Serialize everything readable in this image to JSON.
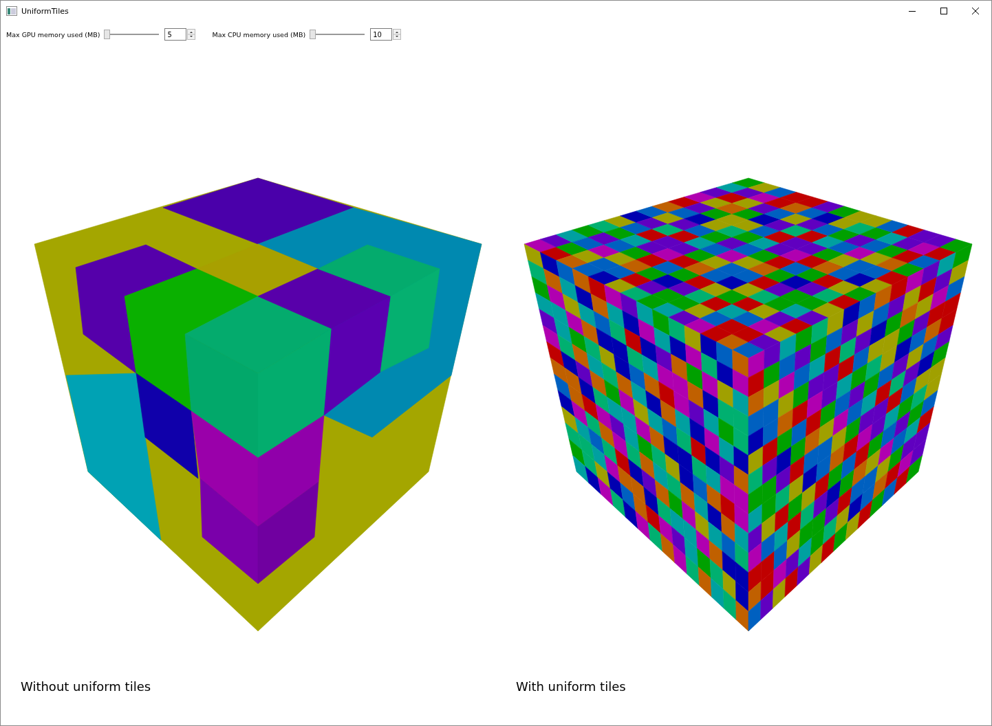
{
  "window": {
    "title": "UniformTiles"
  },
  "controls": [
    {
      "label": "Max GPU memory used (MB)",
      "level": 0,
      "value": "5"
    },
    {
      "label": "Max CPU memory used (MB)",
      "level": 0,
      "value": "10"
    }
  ],
  "views": [
    {
      "kind": "coarse",
      "caption": "Without uniform tiles"
    },
    {
      "kind": "fine",
      "caption": "With uniform tiles"
    }
  ]
}
